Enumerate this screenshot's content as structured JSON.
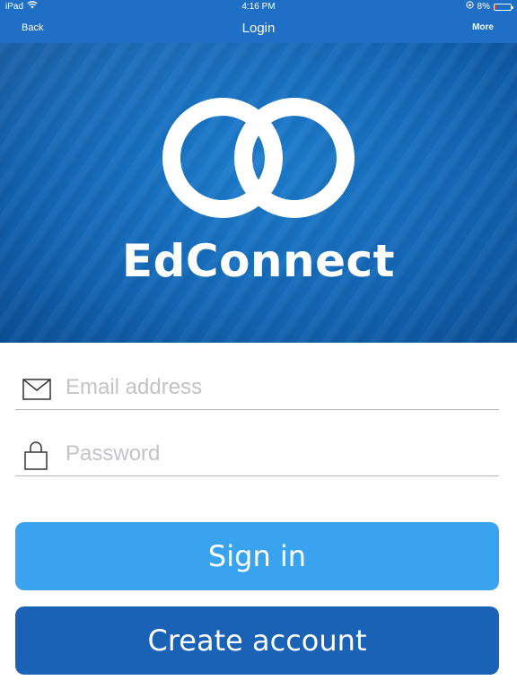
{
  "status_bar": {
    "device": "iPad",
    "time": "4:16 PM",
    "battery": "8%",
    "battery_level": 0.08,
    "battery_color": "#ff3b30"
  },
  "nav": {
    "back_label": "Back",
    "title": "Login",
    "more_label": "More"
  },
  "hero": {
    "brand_name": "EdConnect"
  },
  "form": {
    "email": {
      "value": "",
      "placeholder": "Email address"
    },
    "password": {
      "value": "",
      "placeholder": "Password"
    }
  },
  "buttons": {
    "sign_in": "Sign in",
    "create_account": "Create account"
  },
  "colors": {
    "nav_bar": "#1f6fc7",
    "sign_in_button": "#3aa3ef",
    "create_account_button": "#1a62b5"
  }
}
